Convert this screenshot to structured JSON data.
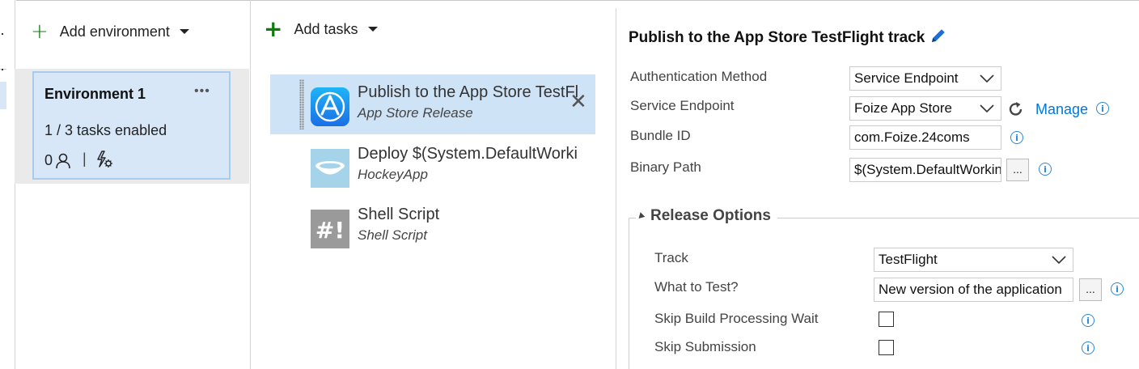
{
  "environments": {
    "add_label": "Add environment",
    "card": {
      "title": "Environment 1",
      "more": "•••",
      "status": "1 / 3 tasks enabled",
      "approvers_count": "0",
      "separator": "|"
    }
  },
  "tasks": {
    "add_label": "Add tasks",
    "items": [
      {
        "name": "Publish to the App Store TestFlight track",
        "subtitle": "App Store Release",
        "icon": "app-store-icon",
        "selected": true
      },
      {
        "name": "Deploy $(System.DefaultWorkingDirectory)",
        "subtitle": "HockeyApp",
        "icon": "hockeyapp-icon",
        "selected": false
      },
      {
        "name": "Shell Script",
        "subtitle": "Shell Script",
        "icon": "shell-script-icon",
        "selected": false
      }
    ],
    "remove_glyph": "✕"
  },
  "details": {
    "title": "Publish to the App Store TestFlight track",
    "fields": {
      "auth_method": {
        "label": "Authentication Method",
        "value": "Service Endpoint"
      },
      "service_endpoint": {
        "label": "Service Endpoint",
        "value": "Foize App Store",
        "manage": "Manage"
      },
      "bundle_id": {
        "label": "Bundle ID",
        "value": "com.Foize.24coms"
      },
      "binary_path": {
        "label": "Binary Path",
        "value": "$(System.DefaultWorkingDirectory)",
        "browse": "..."
      }
    },
    "release_options": {
      "legend": "Release Options",
      "track": {
        "label": "Track",
        "value": "TestFlight"
      },
      "what_to_test": {
        "label": "What to Test?",
        "value": "New version of the application",
        "browse": "..."
      },
      "skip_build_processing_wait": {
        "label": "Skip Build Processing Wait",
        "checked": false
      },
      "skip_submission": {
        "label": "Skip Submission",
        "checked": false
      }
    },
    "info_glyph": "i"
  },
  "colors": {
    "accent_green": "#107c10",
    "link_blue": "#0078d7",
    "selection_blue": "#cfe3f7",
    "env_card_blue": "#d7e7f8"
  }
}
